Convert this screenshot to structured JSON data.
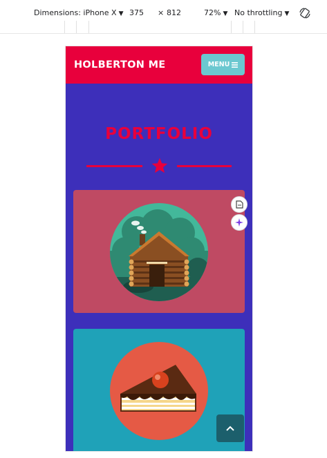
{
  "devtools": {
    "device_label": "Dimensions: iPhone X",
    "width_value": "375",
    "times_symbol": "×",
    "height_value": "812",
    "zoom": "72%",
    "throttling": "No throttling",
    "icons": [
      "rotate-icon",
      "caret-down-icon"
    ]
  },
  "site": {
    "brand": "HOLBERTON ME",
    "menu_label": "MENU",
    "menu_icon": "hamburger-icon",
    "section_title": "PORTFOLIO",
    "divider_icon": "star-icon",
    "colors": {
      "primary": "#e8003c",
      "background": "#3d2fba",
      "menu_button": "#6bc8d0",
      "card_1": "#bf4a63",
      "card_2": "#1fa2b8",
      "back_to_top": "#1c5f6c"
    },
    "portfolio_items": [
      {
        "image": "cabin-icon"
      },
      {
        "image": "cake-icon"
      }
    ],
    "back_to_top_icon": "chevron-up-icon",
    "floating_icons": [
      "page-icon",
      "sparkle-icon"
    ]
  }
}
